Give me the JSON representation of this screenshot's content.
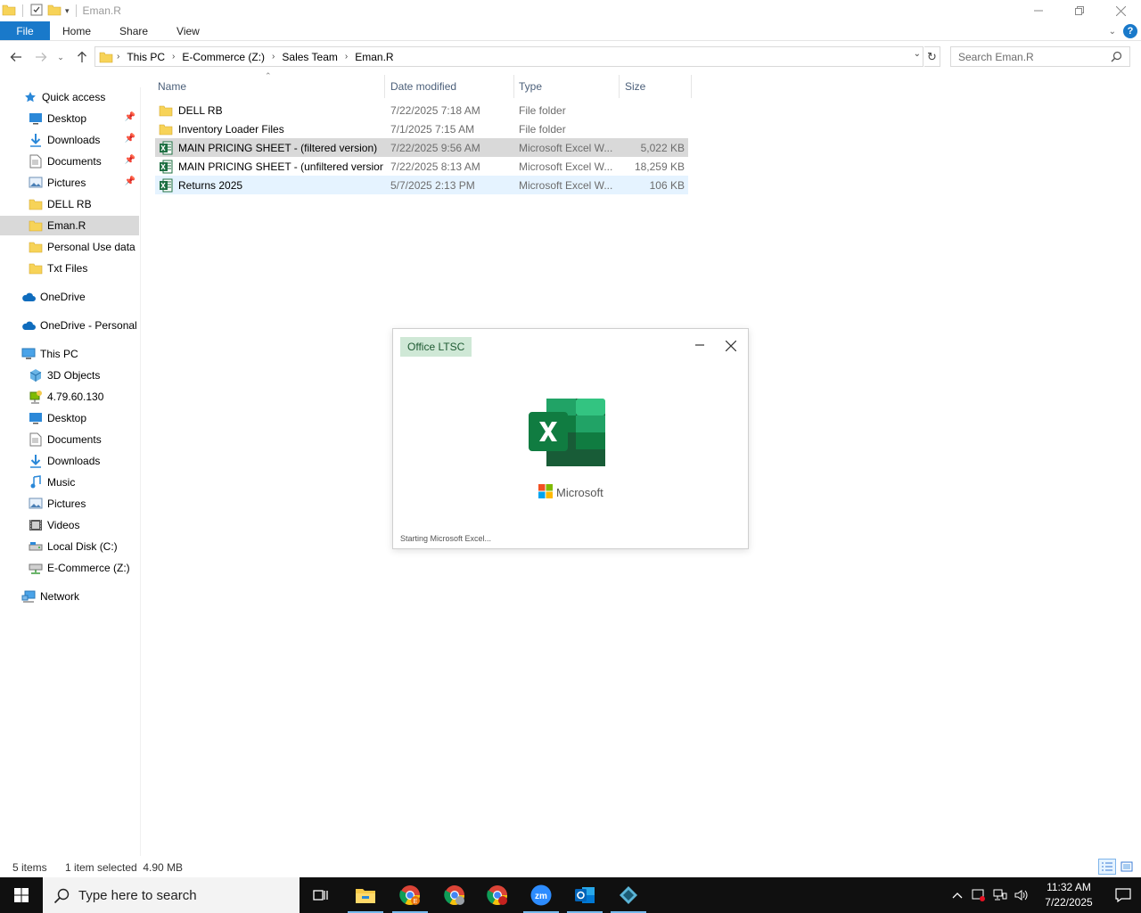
{
  "window": {
    "title": "Eman.R",
    "controls": [
      "minimize-icon",
      "restore-icon",
      "close-icon"
    ]
  },
  "ribbon": {
    "tabs": [
      {
        "label": "File",
        "active": true
      },
      {
        "label": "Home"
      },
      {
        "label": "Share"
      },
      {
        "label": "View"
      }
    ]
  },
  "address": {
    "crumbs": [
      "This PC",
      "E-Commerce (Z:)",
      "Sales Team",
      "Eman.R"
    ],
    "search_placeholder": "Search Eman.R"
  },
  "nav": {
    "quick_access": "Quick access",
    "quick_items": [
      {
        "label": "Desktop",
        "icon": "desktop-icon",
        "pinned": true
      },
      {
        "label": "Downloads",
        "icon": "download-icon",
        "pinned": true
      },
      {
        "label": "Documents",
        "icon": "documents-icon",
        "pinned": true
      },
      {
        "label": "Pictures",
        "icon": "pictures-icon",
        "pinned": true
      },
      {
        "label": "DELL RB",
        "icon": "folder-icon"
      },
      {
        "label": "Eman.R",
        "icon": "folder-icon",
        "selected": true
      },
      {
        "label": "Personal Use data",
        "icon": "folder-icon"
      },
      {
        "label": "Txt Files",
        "icon": "folder-icon"
      }
    ],
    "onedrive": "OneDrive",
    "onedrive_personal": "OneDrive - Personal",
    "this_pc": "This PC",
    "pc_items": [
      {
        "label": "3D Objects",
        "icon": "3d-objects-icon"
      },
      {
        "label": "4.79.60.130",
        "icon": "network-drive-icon"
      },
      {
        "label": "Desktop",
        "icon": "desktop-icon"
      },
      {
        "label": "Documents",
        "icon": "documents-icon"
      },
      {
        "label": "Downloads",
        "icon": "download-icon"
      },
      {
        "label": "Music",
        "icon": "music-icon"
      },
      {
        "label": "Pictures",
        "icon": "pictures-icon"
      },
      {
        "label": "Videos",
        "icon": "videos-icon"
      },
      {
        "label": "Local Disk (C:)",
        "icon": "local-disk-icon"
      },
      {
        "label": "E-Commerce (Z:)",
        "icon": "mapped-drive-icon"
      }
    ],
    "network": "Network"
  },
  "columns": {
    "name": "Name",
    "date": "Date modified",
    "type": "Type",
    "size": "Size"
  },
  "files": [
    {
      "name": "DELL RB",
      "date": "7/22/2025 7:18 AM",
      "type": "File folder",
      "size": "",
      "icon": "folder-icon"
    },
    {
      "name": "Inventory Loader Files",
      "date": "7/1/2025 7:15 AM",
      "type": "File folder",
      "size": "",
      "icon": "folder-icon"
    },
    {
      "name": "MAIN PRICING SHEET - (filtered version)",
      "date": "7/22/2025 9:56 AM",
      "type": "Microsoft Excel W...",
      "size": "5,022 KB",
      "icon": "excel-file-icon",
      "state": "selected"
    },
    {
      "name": "MAIN PRICING SHEET - (unfiltered version)",
      "date": "7/22/2025 8:13 AM",
      "type": "Microsoft Excel W...",
      "size": "18,259 KB",
      "icon": "excel-file-icon"
    },
    {
      "name": "Returns 2025",
      "date": "5/7/2025 2:13 PM",
      "type": "Microsoft Excel W...",
      "size": "106 KB",
      "icon": "excel-file-icon",
      "state": "hover"
    }
  ],
  "splash": {
    "badge": "Office LTSC",
    "brand": "Microsoft",
    "status": "Starting Microsoft Excel..."
  },
  "status": {
    "count": "5 items",
    "selection": "1 item selected  4.90 MB"
  },
  "taskbar": {
    "search_placeholder": "Type here to search",
    "time": "11:32 AM",
    "date": "7/22/2025"
  },
  "colors": {
    "accent": "#1979ca",
    "selected_row": "#d9d9d9",
    "hover_row": "#e5f3ff",
    "folder": "#f7d358",
    "excel_green": "#1d6f42",
    "taskbar": "#101010"
  }
}
